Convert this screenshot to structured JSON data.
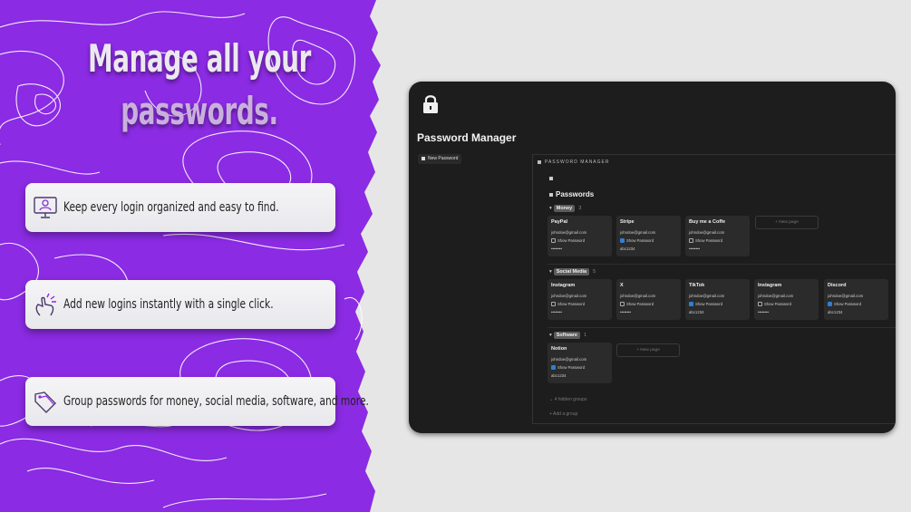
{
  "hero": {
    "line1": "Manage all your",
    "line2": "passwords."
  },
  "features": [
    {
      "icon": "monitor-user-icon",
      "text": "Keep every login organized and easy to find."
    },
    {
      "icon": "hand-tap-icon",
      "text": "Add new logins instantly with a single click."
    },
    {
      "icon": "tags-icon",
      "text": "Group passwords for money, social media, software, and more."
    }
  ],
  "app": {
    "icon": "lock-icon",
    "title": "Password Manager",
    "new_button": "New Password",
    "panel_header": "PASSWORD MANAGER",
    "db_title": "Passwords",
    "show_label": "Show Password",
    "new_page": "+ New page",
    "hidden_groups": "4 hidden groups",
    "add_group": "+ Add a group",
    "groups": [
      {
        "name": "Money",
        "count": "3",
        "cards": [
          {
            "name": "PayPal",
            "email": "johndoe@gmail.com",
            "checked": false,
            "password": "••••••••"
          },
          {
            "name": "Stripe",
            "email": "johndoe@gmail.com",
            "checked": true,
            "password": "abc1234"
          },
          {
            "name": "Buy me a Coffe",
            "email": "johndoe@gmail.com",
            "checked": false,
            "password": "••••••••"
          }
        ]
      },
      {
        "name": "Social Media",
        "count": "5",
        "cards": [
          {
            "name": "Instagram",
            "email": "johndoe@gmail.com",
            "checked": false,
            "password": "••••••••"
          },
          {
            "name": "X",
            "email": "johndoe@gmail.com",
            "checked": false,
            "password": "••••••••"
          },
          {
            "name": "TikTok",
            "email": "johndoe@gmail.com",
            "checked": true,
            "password": "abc1234"
          },
          {
            "name": "Instagram",
            "email": "johndoe@gmail.com",
            "checked": false,
            "password": "••••••••"
          },
          {
            "name": "Discord",
            "email": "johndoe@gmail.com",
            "checked": true,
            "password": "abc1234"
          }
        ]
      },
      {
        "name": "Software",
        "count": "1",
        "cards": [
          {
            "name": "Notion",
            "email": "johndoe@gmail.com",
            "checked": true,
            "password": "abc1234"
          }
        ]
      }
    ]
  },
  "colors": {
    "purple": "#8b2be3",
    "contour": "#ffffff",
    "window": "#1d1d1d",
    "card": "#2b2b2b",
    "check": "#2f7fd6"
  }
}
